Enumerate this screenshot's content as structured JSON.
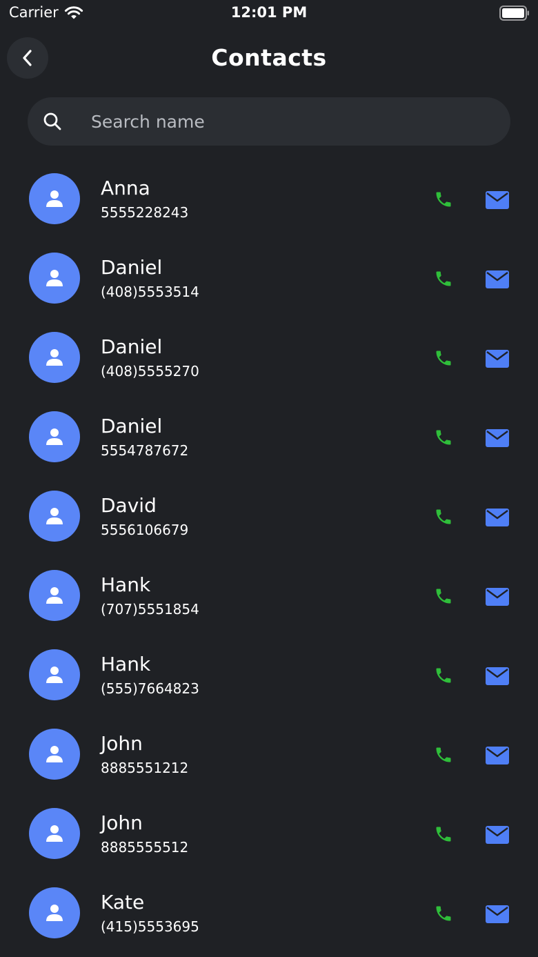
{
  "status_bar": {
    "carrier": "Carrier",
    "time": "12:01 PM"
  },
  "header": {
    "title": "Contacts",
    "back_icon": "chevron-left-icon"
  },
  "search": {
    "placeholder": "Search name",
    "value": "",
    "icon": "search-icon"
  },
  "colors": {
    "background": "#1f2125",
    "surface": "#2b2e33",
    "avatar": "#5a86f7",
    "call": "#2fbe3a",
    "mail": "#4f7ff6"
  },
  "contacts": [
    {
      "name": "Anna",
      "phone": "5555228243"
    },
    {
      "name": "Daniel",
      "phone": "(408)5553514"
    },
    {
      "name": "Daniel",
      "phone": "(408)5555270"
    },
    {
      "name": "Daniel",
      "phone": "5554787672"
    },
    {
      "name": "David",
      "phone": "5556106679"
    },
    {
      "name": "Hank",
      "phone": "(707)5551854"
    },
    {
      "name": "Hank",
      "phone": "(555)7664823"
    },
    {
      "name": "John",
      "phone": "8885551212"
    },
    {
      "name": "John",
      "phone": "8885555512"
    },
    {
      "name": "Kate",
      "phone": "(415)5553695"
    }
  ]
}
